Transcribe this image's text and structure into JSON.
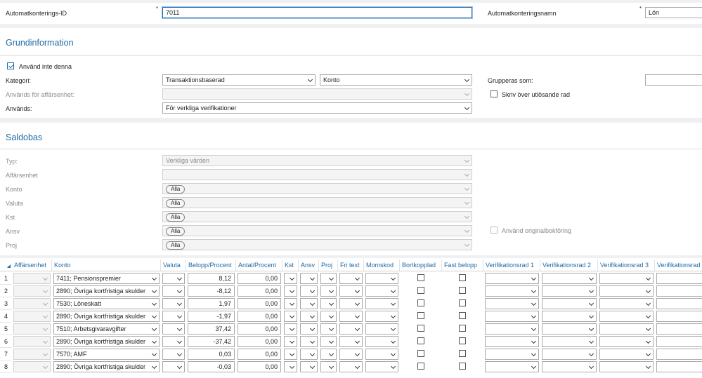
{
  "top": {
    "id_label": "Automatkonterings-ID",
    "id_value": "7011",
    "name_label": "Automatkonteringsnamn",
    "name_value": "Lön",
    "required_mark": "*"
  },
  "grundinfo": {
    "title": "Grundinformation",
    "inactive_label": "Använd inte denna",
    "inactive_checked": true,
    "kategori_label": "Kategori:",
    "kategori_value": "Transaktionsbaserad",
    "kategori2_value": "Konto",
    "grupperas_label": "Grupperas som:",
    "grupperas_value": "",
    "affarsenhet_label": "Används för affärsenhet:",
    "affarsenhet_value": "",
    "skriv_label": "Skriv över utlösande rad",
    "anvands_label": "Används:",
    "anvands_value": "För verkliga verifikationer"
  },
  "saldobas": {
    "title": "Saldobas",
    "typ_label": "Typ:",
    "typ_value": "Verkliga värden",
    "affarsenhet_label": "Affärsenhet",
    "konto_label": "Konto",
    "konto_value": "Alla",
    "valuta_label": "Valuta",
    "valuta_value": "Alla",
    "kst_label": "Kst",
    "kst_value": "Alla",
    "ansv_label": "Ansv",
    "ansv_value": "Alla",
    "proj_label": "Proj",
    "proj_value": "Alla",
    "original_label": "Använd originalbokföring"
  },
  "grid": {
    "headers": {
      "affarsenhet": "Affärsenhet",
      "konto": "Konto",
      "valuta": "Valuta",
      "belopp": "Belopp/Procent",
      "antal": "Antal/Procent",
      "kst": "Kst",
      "ansv": "Ansv",
      "proj": "Proj",
      "fritext": "Fri text",
      "momskod": "Momskod",
      "bortkopplad": "Bortkopplad",
      "fastbelopp": "Fast belopp",
      "ver1": "Verifikationsrad 1",
      "ver2": "Verifikationsrad 2",
      "ver3": "Verifikationsrad 3",
      "ver4": "Verifikationsrad"
    },
    "rows": [
      {
        "num": "1",
        "konto": "7411; Pensionspremier",
        "belopp": "8,12",
        "antal": "0,00"
      },
      {
        "num": "2",
        "konto": "2890; Övriga kortfristiga skulder",
        "belopp": "-8,12",
        "antal": "0,00"
      },
      {
        "num": "3",
        "konto": "7530; Löneskatt",
        "belopp": "1,97",
        "antal": "0,00"
      },
      {
        "num": "4",
        "konto": "2890; Övriga kortfristiga skulder",
        "belopp": "-1,97",
        "antal": "0,00"
      },
      {
        "num": "5",
        "konto": "7510; Arbetsgivaravgifter",
        "belopp": "37,42",
        "antal": "0,00"
      },
      {
        "num": "6",
        "konto": "2890; Övriga kortfristiga skulder",
        "belopp": "-37,42",
        "antal": "0,00"
      },
      {
        "num": "7",
        "konto": "7570; AMF",
        "belopp": "0,03",
        "antal": "0,00"
      },
      {
        "num": "8",
        "konto": "2890; Övriga kortfristiga skulder",
        "belopp": "-0,03",
        "antal": "0,00"
      }
    ]
  }
}
